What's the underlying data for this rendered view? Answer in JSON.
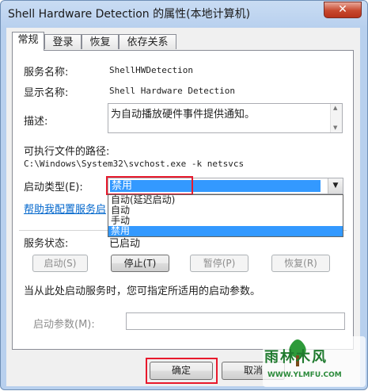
{
  "window": {
    "title": "Shell Hardware Detection 的属性(本地计算机)",
    "close_label": "✕"
  },
  "tabs": [
    {
      "label": "常规"
    },
    {
      "label": "登录"
    },
    {
      "label": "恢复"
    },
    {
      "label": "依存关系"
    }
  ],
  "general": {
    "service_name_label": "服务名称:",
    "service_name": "ShellHWDetection",
    "display_name_label": "显示名称:",
    "display_name": "Shell Hardware Detection",
    "description_label": "描述:",
    "description": "为自动播放硬件事件提供通知。",
    "path_label": "可执行文件的路径:",
    "path": "C:\\Windows\\System32\\svchost.exe -k netsvcs",
    "startup_type_label": "启动类型(E):",
    "startup_type_value": "禁用",
    "startup_options": [
      "自动(延迟启动)",
      "自动",
      "手动",
      "禁用"
    ],
    "help_link": "帮助我配置服务启",
    "status_label": "服务状态:",
    "status_value": "已启动",
    "buttons": {
      "start": "启动(S)",
      "stop": "停止(T)",
      "pause": "暂停(P)",
      "resume": "恢复(R)"
    },
    "start_params_hint": "当从此处启动服务时，您可指定所适用的启动参数。",
    "start_params_label": "启动参数(M):",
    "start_params_value": ""
  },
  "footer": {
    "ok": "确定",
    "cancel": "取消"
  },
  "watermark": {
    "name": "雨林木风",
    "url": "WWW.YLMFU.COM"
  },
  "colors": {
    "highlight_box": "#e8192c",
    "selection": "#3399ff",
    "link": "#0066cc"
  }
}
